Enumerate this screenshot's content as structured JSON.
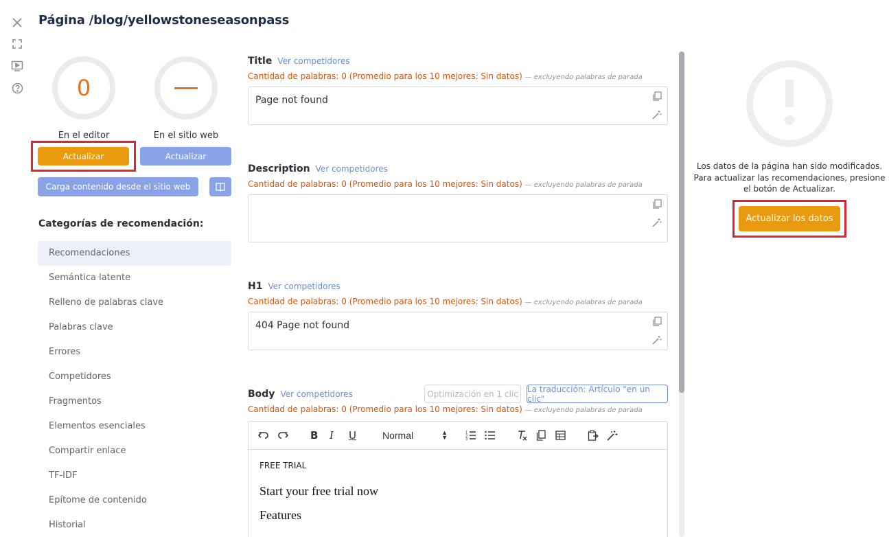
{
  "page_title": "Página /blog/yellowstoneseasonpass",
  "rail": {
    "icons": [
      "close-icon",
      "fullscreen-icon",
      "video-tutorial-icon",
      "help-icon"
    ]
  },
  "scores": {
    "editor": {
      "value": "0",
      "label": "En el editor",
      "button": "Actualizar"
    },
    "website": {
      "value": "—",
      "label": "En el sitio web",
      "button": "Actualizar"
    }
  },
  "load_button": "Carga contenido desde el sitio web",
  "categories": {
    "heading": "Categorías de recomendación:",
    "items": [
      "Recomendaciones",
      "Semántica latente",
      "Relleno de palabras clave",
      "Palabras clave",
      "Errores",
      "Competidores",
      "Fragmentos",
      "Elementos esenciales",
      "Compartir enlace",
      "TF-IDF",
      "Epítome de contenido",
      "Historial"
    ]
  },
  "fields": {
    "see_competitors": "Ver competidores",
    "word_count": "Cantidad de palabras: 0 (Promedio para los 10 mejores: Sin datos)",
    "word_count_note": "— excluyendo palabras de parada",
    "title": {
      "label": "Title",
      "value": "Page not found"
    },
    "description": {
      "label": "Description",
      "value": ""
    },
    "h1": {
      "label": "H1",
      "value": "404 Page not found"
    },
    "body": {
      "label": "Body",
      "one_click": "Optimización en 1 clic",
      "translation": "La traducción: Artículo \"en un clic\"",
      "format_select": "Normal",
      "content": {
        "line1": "FREE TRIAL",
        "line2": "Start your free trial now",
        "line3": "Features"
      }
    }
  },
  "right_panel": {
    "message_line1": "Los datos de la página han sido modificados.",
    "message_line2": "Para actualizar las recomendaciones, presione",
    "message_line3": "el botón de Actualizar.",
    "button": "Actualizar los datos"
  },
  "colors": {
    "accent_orange": "#e99a0f",
    "accent_blue": "#8aa3e8",
    "warning_text": "#d9540f",
    "highlight": "#e0242f"
  }
}
